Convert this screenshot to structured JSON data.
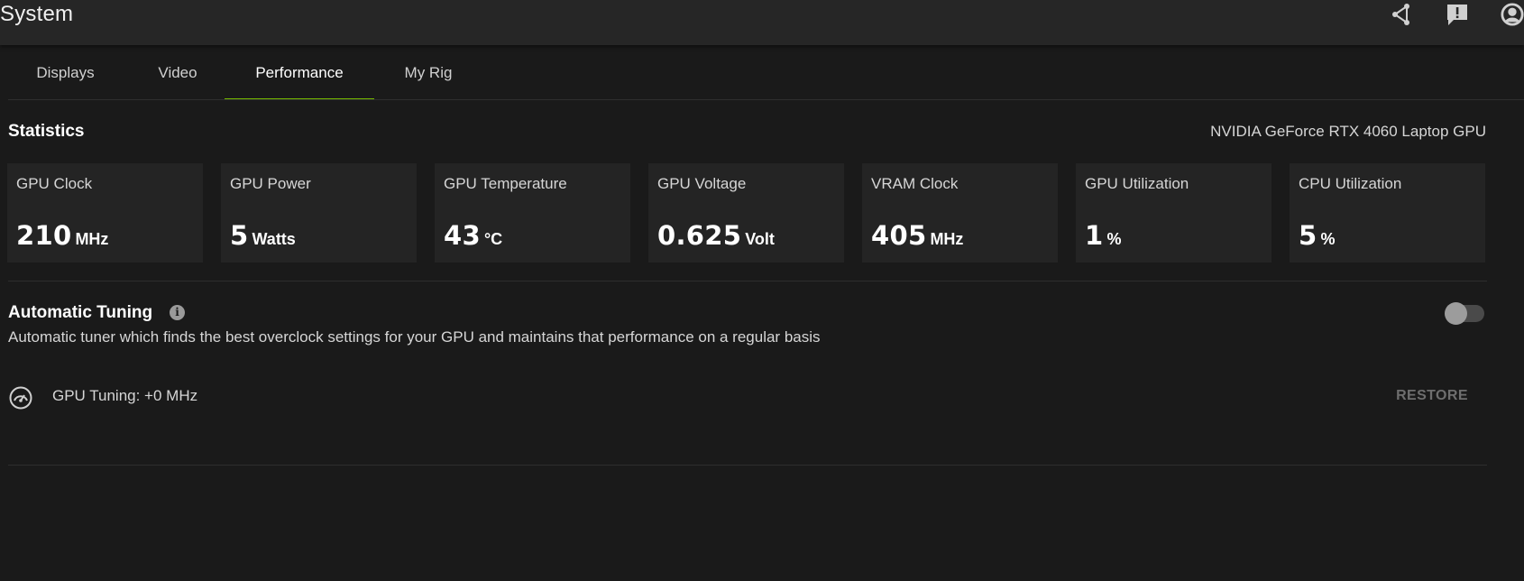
{
  "window": {
    "title": "System"
  },
  "top_icons": [
    {
      "icon": "share-icon"
    },
    {
      "icon": "feedback-icon"
    },
    {
      "icon": "profile-icon"
    }
  ],
  "tabs": [
    {
      "label": "Displays",
      "active": false
    },
    {
      "label": "Video",
      "active": false
    },
    {
      "label": "Performance",
      "active": true
    },
    {
      "label": "My Rig",
      "active": false
    }
  ],
  "statistics": {
    "title": "Statistics",
    "gpu_name": "NVIDIA GeForce RTX 4060 Laptop GPU",
    "cards": [
      {
        "label": "GPU Clock",
        "value": "210",
        "unit": "MHz"
      },
      {
        "label": "GPU Power",
        "value": "5",
        "unit": "Watts"
      },
      {
        "label": "GPU Temperature",
        "value": "43",
        "unit": "°C"
      },
      {
        "label": "GPU Voltage",
        "value": "0.625",
        "unit": "Volt"
      },
      {
        "label": "VRAM Clock",
        "value": "405",
        "unit": "MHz"
      },
      {
        "label": "GPU Utilization",
        "value": "1",
        "unit": "%"
      },
      {
        "label": "CPU Utilization",
        "value": "5",
        "unit": "%"
      }
    ]
  },
  "automatic_tuning": {
    "title": "Automatic Tuning",
    "description": "Automatic tuner which finds the best overclock settings for your GPU and maintains that performance on a regular basis",
    "toggle_on": false,
    "tuning_status": "GPU Tuning: +0 MHz",
    "restore_label": "RESTORE"
  },
  "colors": {
    "accent": "#76b900",
    "background": "#1a1a1a",
    "card": "#242424",
    "topbar": "#262626"
  }
}
